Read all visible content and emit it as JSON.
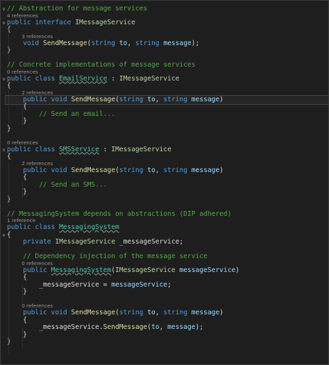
{
  "editor": {
    "lines": [
      {
        "type": "code",
        "parts": [
          {
            "c": "cm",
            "t": "// Abstraction for message services"
          }
        ]
      },
      {
        "type": "lens",
        "text": "4 references"
      },
      {
        "type": "code",
        "parts": [
          {
            "c": "kw",
            "t": "public"
          },
          {
            "c": "pu",
            "t": " "
          },
          {
            "c": "kw",
            "t": "interface"
          },
          {
            "c": "pu",
            "t": " "
          },
          {
            "c": "ty",
            "t": "IMessageService"
          }
        ]
      },
      {
        "type": "code",
        "parts": [
          {
            "c": "pu",
            "t": "{"
          }
        ]
      },
      {
        "type": "lens",
        "text": "3 references",
        "indent": 1
      },
      {
        "type": "code",
        "parts": [
          {
            "c": "pu",
            "t": "    "
          },
          {
            "c": "kw",
            "t": "void"
          },
          {
            "c": "pu",
            "t": " "
          },
          {
            "c": "fn",
            "t": "SendMessage"
          },
          {
            "c": "pu",
            "t": "("
          },
          {
            "c": "kw",
            "t": "string"
          },
          {
            "c": "pu",
            "t": " "
          },
          {
            "c": "pm",
            "t": "to"
          },
          {
            "c": "pu",
            "t": ", "
          },
          {
            "c": "kw",
            "t": "string"
          },
          {
            "c": "pu",
            "t": " "
          },
          {
            "c": "pm",
            "t": "message"
          },
          {
            "c": "pu",
            "t": ");"
          }
        ]
      },
      {
        "type": "code",
        "parts": [
          {
            "c": "pu",
            "t": "}"
          }
        ]
      },
      {
        "type": "blank"
      },
      {
        "type": "code",
        "parts": [
          {
            "c": "cm",
            "t": "// Concrete implementations of message services"
          }
        ]
      },
      {
        "type": "lens",
        "text": "0 references"
      },
      {
        "type": "code",
        "parts": [
          {
            "c": "kw",
            "t": "public"
          },
          {
            "c": "pu",
            "t": " "
          },
          {
            "c": "kw",
            "t": "class"
          },
          {
            "c": "pu",
            "t": " "
          },
          {
            "c": "id sq",
            "t": "EmailService"
          },
          {
            "c": "pu",
            "t": " : "
          },
          {
            "c": "ty",
            "t": "IMessageService"
          }
        ]
      },
      {
        "type": "code",
        "parts": [
          {
            "c": "pu",
            "t": "{"
          }
        ]
      },
      {
        "type": "lens",
        "text": "2 references",
        "indent": 1
      },
      {
        "type": "code",
        "highlight": true,
        "parts": [
          {
            "c": "pu",
            "t": "    "
          },
          {
            "c": "kw",
            "t": "public"
          },
          {
            "c": "pu",
            "t": " "
          },
          {
            "c": "kw",
            "t": "void"
          },
          {
            "c": "pu",
            "t": " "
          },
          {
            "c": "fn",
            "t": "SendMessage"
          },
          {
            "c": "pu",
            "t": "("
          },
          {
            "c": "kw",
            "t": "string"
          },
          {
            "c": "pu",
            "t": " "
          },
          {
            "c": "pm",
            "t": "to"
          },
          {
            "c": "pu",
            "t": ", "
          },
          {
            "c": "kw",
            "t": "string"
          },
          {
            "c": "pu",
            "t": " "
          },
          {
            "c": "pm",
            "t": "message"
          },
          {
            "c": "pu",
            "t": ")"
          }
        ]
      },
      {
        "type": "code",
        "parts": [
          {
            "c": "pu",
            "t": "    {"
          }
        ]
      },
      {
        "type": "code",
        "parts": [
          {
            "c": "pu",
            "t": "        "
          },
          {
            "c": "cm",
            "t": "// Send an email..."
          }
        ]
      },
      {
        "type": "code",
        "parts": [
          {
            "c": "pu",
            "t": "    }"
          }
        ]
      },
      {
        "type": "code",
        "parts": [
          {
            "c": "pu",
            "t": "}"
          }
        ]
      },
      {
        "type": "blank"
      },
      {
        "type": "lens",
        "text": "0 references"
      },
      {
        "type": "code",
        "parts": [
          {
            "c": "kw",
            "t": "public"
          },
          {
            "c": "pu",
            "t": " "
          },
          {
            "c": "kw",
            "t": "class"
          },
          {
            "c": "pu",
            "t": " "
          },
          {
            "c": "id sq",
            "t": "SMSService"
          },
          {
            "c": "pu",
            "t": " : "
          },
          {
            "c": "ty",
            "t": "IMessageService"
          }
        ]
      },
      {
        "type": "code",
        "parts": [
          {
            "c": "pu",
            "t": "{"
          }
        ]
      },
      {
        "type": "lens",
        "text": "2 references",
        "indent": 1
      },
      {
        "type": "code",
        "parts": [
          {
            "c": "pu",
            "t": "    "
          },
          {
            "c": "kw",
            "t": "public"
          },
          {
            "c": "pu",
            "t": " "
          },
          {
            "c": "kw",
            "t": "void"
          },
          {
            "c": "pu",
            "t": " "
          },
          {
            "c": "fn",
            "t": "SendMessage"
          },
          {
            "c": "pu",
            "t": "("
          },
          {
            "c": "kw",
            "t": "string"
          },
          {
            "c": "pu",
            "t": " "
          },
          {
            "c": "pm",
            "t": "to"
          },
          {
            "c": "pu",
            "t": ", "
          },
          {
            "c": "kw",
            "t": "string"
          },
          {
            "c": "pu",
            "t": " "
          },
          {
            "c": "pm",
            "t": "message"
          },
          {
            "c": "pu",
            "t": ")"
          }
        ]
      },
      {
        "type": "code",
        "parts": [
          {
            "c": "pu",
            "t": "    {"
          }
        ]
      },
      {
        "type": "code",
        "parts": [
          {
            "c": "pu",
            "t": "        "
          },
          {
            "c": "cm",
            "t": "// Send an SMS..."
          }
        ]
      },
      {
        "type": "code",
        "parts": [
          {
            "c": "pu",
            "t": "    }"
          }
        ]
      },
      {
        "type": "code",
        "parts": [
          {
            "c": "pu",
            "t": "}"
          }
        ]
      },
      {
        "type": "blank"
      },
      {
        "type": "code",
        "parts": [
          {
            "c": "cm",
            "t": "// MessagingSystem depends on abstractions (DIP adhered)"
          }
        ]
      },
      {
        "type": "lens",
        "text": "1 reference"
      },
      {
        "type": "code",
        "parts": [
          {
            "c": "kw",
            "t": "public"
          },
          {
            "c": "pu",
            "t": " "
          },
          {
            "c": "kw",
            "t": "class"
          },
          {
            "c": "pu",
            "t": " "
          },
          {
            "c": "id sq",
            "t": "MessagingSystem"
          }
        ]
      },
      {
        "type": "code",
        "parts": [
          {
            "c": "pu",
            "t": "{"
          }
        ]
      },
      {
        "type": "code",
        "parts": [
          {
            "c": "pu",
            "t": "    "
          },
          {
            "c": "kw",
            "t": "private"
          },
          {
            "c": "pu",
            "t": " "
          },
          {
            "c": "ty",
            "t": "IMessageService"
          },
          {
            "c": "pu",
            "t": " _messageService;"
          }
        ]
      },
      {
        "type": "blank"
      },
      {
        "type": "code",
        "parts": [
          {
            "c": "pu",
            "t": "    "
          },
          {
            "c": "cm",
            "t": "// Dependency injection of the message service"
          }
        ]
      },
      {
        "type": "lens",
        "text": "0 references",
        "indent": 1
      },
      {
        "type": "code",
        "parts": [
          {
            "c": "pu",
            "t": "    "
          },
          {
            "c": "kw",
            "t": "public"
          },
          {
            "c": "pu",
            "t": " "
          },
          {
            "c": "id sq",
            "t": "MessagingSystem"
          },
          {
            "c": "pu",
            "t": "("
          },
          {
            "c": "ty",
            "t": "IMessageService"
          },
          {
            "c": "pu",
            "t": " "
          },
          {
            "c": "pm",
            "t": "messageService"
          },
          {
            "c": "pu",
            "t": ")"
          }
        ]
      },
      {
        "type": "code",
        "parts": [
          {
            "c": "pu",
            "t": "    {"
          }
        ]
      },
      {
        "type": "code",
        "parts": [
          {
            "c": "pu",
            "t": "        _messageService = "
          },
          {
            "c": "pm",
            "t": "messageService"
          },
          {
            "c": "pu",
            "t": ";"
          }
        ]
      },
      {
        "type": "code",
        "parts": [
          {
            "c": "pu",
            "t": "    }"
          }
        ]
      },
      {
        "type": "blank"
      },
      {
        "type": "lens",
        "text": "0 references",
        "indent": 1
      },
      {
        "type": "code",
        "parts": [
          {
            "c": "pu",
            "t": "    "
          },
          {
            "c": "kw",
            "t": "public"
          },
          {
            "c": "pu",
            "t": " "
          },
          {
            "c": "kw",
            "t": "void"
          },
          {
            "c": "pu",
            "t": " "
          },
          {
            "c": "fn",
            "t": "SendMessage"
          },
          {
            "c": "pu",
            "t": "("
          },
          {
            "c": "kw",
            "t": "string"
          },
          {
            "c": "pu",
            "t": " "
          },
          {
            "c": "pm",
            "t": "to"
          },
          {
            "c": "pu",
            "t": ", "
          },
          {
            "c": "kw",
            "t": "string"
          },
          {
            "c": "pu",
            "t": " "
          },
          {
            "c": "pm",
            "t": "message"
          },
          {
            "c": "pu",
            "t": ")"
          }
        ]
      },
      {
        "type": "code",
        "parts": [
          {
            "c": "pu",
            "t": "    {"
          }
        ]
      },
      {
        "type": "code",
        "parts": [
          {
            "c": "pu",
            "t": "        _messageService."
          },
          {
            "c": "fn",
            "t": "SendMessage"
          },
          {
            "c": "pu",
            "t": "("
          },
          {
            "c": "pm",
            "t": "to"
          },
          {
            "c": "pu",
            "t": ", "
          },
          {
            "c": "pm",
            "t": "message"
          },
          {
            "c": "pu",
            "t": ");"
          }
        ]
      },
      {
        "type": "code",
        "parts": [
          {
            "c": "pu",
            "t": "    }"
          }
        ]
      },
      {
        "type": "code",
        "parts": [
          {
            "c": "pu",
            "t": "}"
          }
        ]
      }
    ]
  }
}
